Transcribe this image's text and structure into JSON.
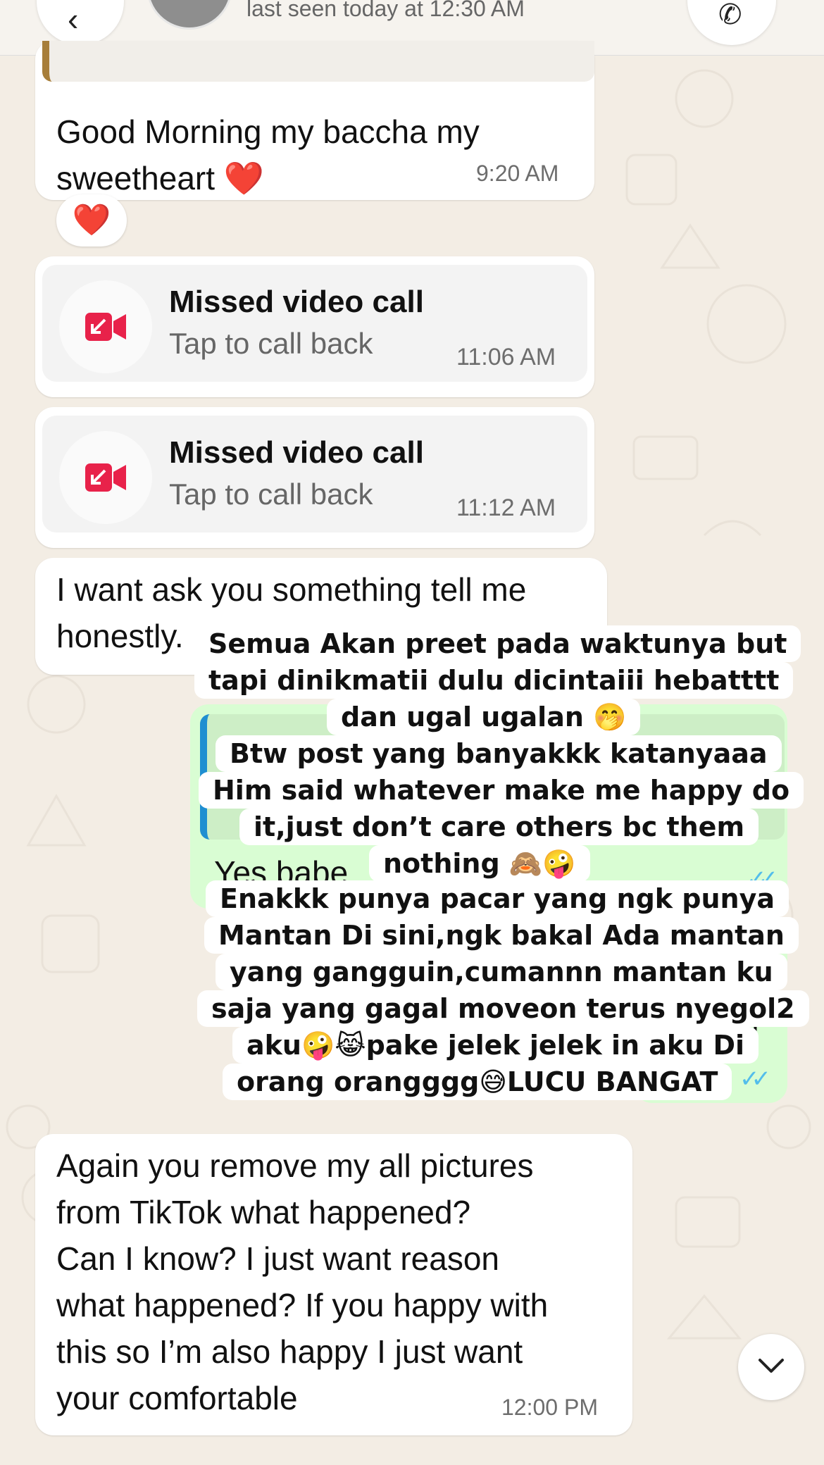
{
  "header": {
    "back_icon": "‹",
    "last_seen": "last seen today at 12:30 AM",
    "call_icon": "call-icon"
  },
  "messages": {
    "good_morning": {
      "text": "Good Morning my baccha my\nsweetheart ❤️",
      "time": "9:20 AM",
      "reaction": "❤️"
    },
    "missed_call_1": {
      "title": "Missed video call",
      "subtitle": "Tap to call back",
      "time": "11:06 AM"
    },
    "missed_call_2": {
      "title": "Missed video call",
      "subtitle": "Tap to call back",
      "time": "11:12 AM"
    },
    "ask": {
      "text": "I want ask you something tell me\nhonestly."
    },
    "reply_yes": {
      "text": "Yes babe"
    },
    "again": {
      "text": "Again you remove my all pictures\nfrom TikTok what happened?\nCan I know? I just want reason\nwhat happened? If you happy with\nthis so I’m also happy I just want\nyour comfortable",
      "time": "12:00 PM"
    }
  },
  "overlay_text": {
    "lines": [
      "Semua Akan preet pada waktunya but",
      "tapi dinikmatii dulu dicintaiii hebatttt",
      "dan ugal ugalan 🤭",
      "Btw post yang banyakkk katanyaaa",
      "Him said whatever make me happy do",
      "it,just don’t care others bc them",
      "nothing 🙈🤪",
      "Enakkk punya pacar yang ngk punya",
      "Mantan Di sini,ngk bakal Ada mantan",
      "yang gangguin,cumannn mantan ku",
      "saja yang gagal moveon terus nyegol2",
      "aku🤪😹pake jelek jelek in aku Di",
      "orang orangggg😅LUCU BANGAT"
    ]
  },
  "colors": {
    "background": "#f3ede4",
    "incoming_bubble": "#ffffff",
    "outgoing_bubble": "#d9fdd3",
    "missed_call_red": "#e8224a",
    "read_receipt": "#53bdeb"
  }
}
